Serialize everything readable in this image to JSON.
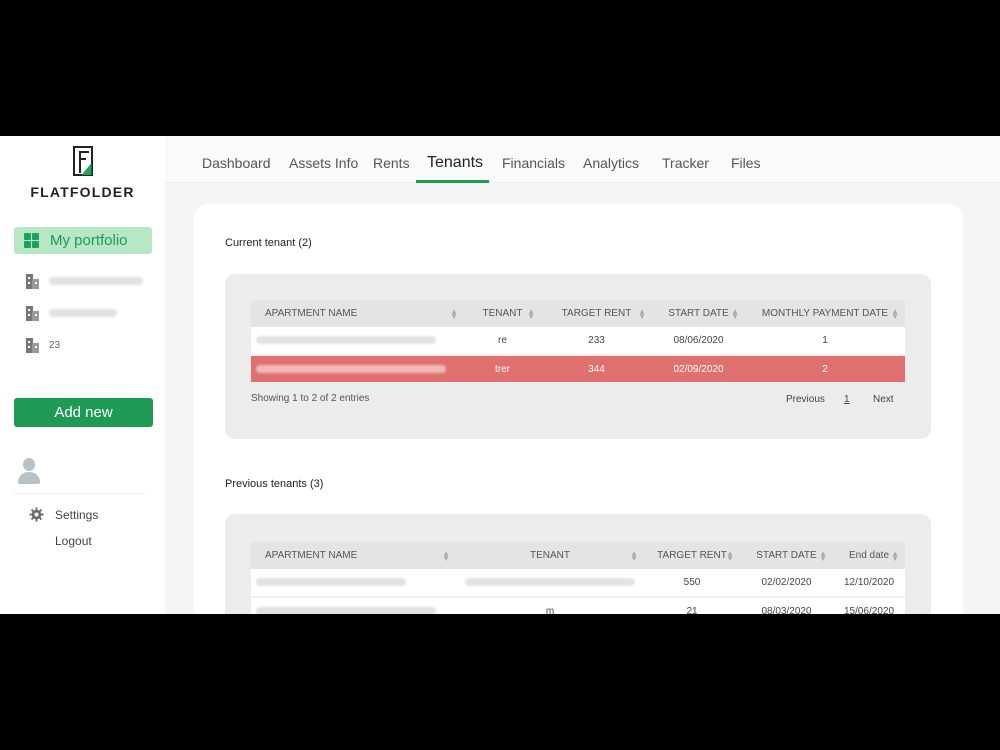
{
  "app": {
    "logo_text": "FLATFOLDER"
  },
  "sidebar": {
    "portfolio_label": "My portfolio",
    "properties": [
      {
        "label": ""
      },
      {
        "label": ""
      },
      {
        "label": "23"
      }
    ],
    "add_new_label": "Add new",
    "settings_label": "Settings",
    "logout_label": "Logout"
  },
  "tabs": [
    "Dashboard",
    "Assets Info",
    "Rents",
    "Tenants",
    "Financials",
    "Analytics",
    "Tracker",
    "Files"
  ],
  "active_tab": "Tenants",
  "current": {
    "title": "Current tenant (2)",
    "columns": [
      "APARTMENT NAME",
      "TENANT",
      "TARGET RENT",
      "START DATE",
      "MONTHLY PAYMENT DATE"
    ],
    "rows": [
      {
        "apartment": "",
        "tenant": "re",
        "target_rent": "233",
        "start_date": "08/06/2020",
        "payment_date": "1"
      },
      {
        "apartment": "",
        "tenant": "trer",
        "target_rent": "344",
        "start_date": "02/09/2020",
        "payment_date": "2"
      }
    ],
    "showing": "Showing 1 to 2 of 2 entries",
    "pager": {
      "previous": "Previous",
      "page": "1",
      "next": "Next"
    }
  },
  "previous": {
    "title": "Previous tenants (3)",
    "columns": [
      "APARTMENT NAME",
      "TENANT",
      "TARGET RENT",
      "START DATE",
      "End date"
    ],
    "rows": [
      {
        "apartment": "",
        "tenant": "",
        "target_rent": "550",
        "start_date": "02/02/2020",
        "end_date": "12/10/2020"
      },
      {
        "apartment": "",
        "tenant": "m",
        "target_rent": "21",
        "start_date": "08/03/2020",
        "end_date": "15/06/2020"
      }
    ]
  },
  "colors": {
    "brand_green": "#1e9a55",
    "active_nav_bg": "#b8e7c6",
    "selected_row": "#e07070"
  }
}
